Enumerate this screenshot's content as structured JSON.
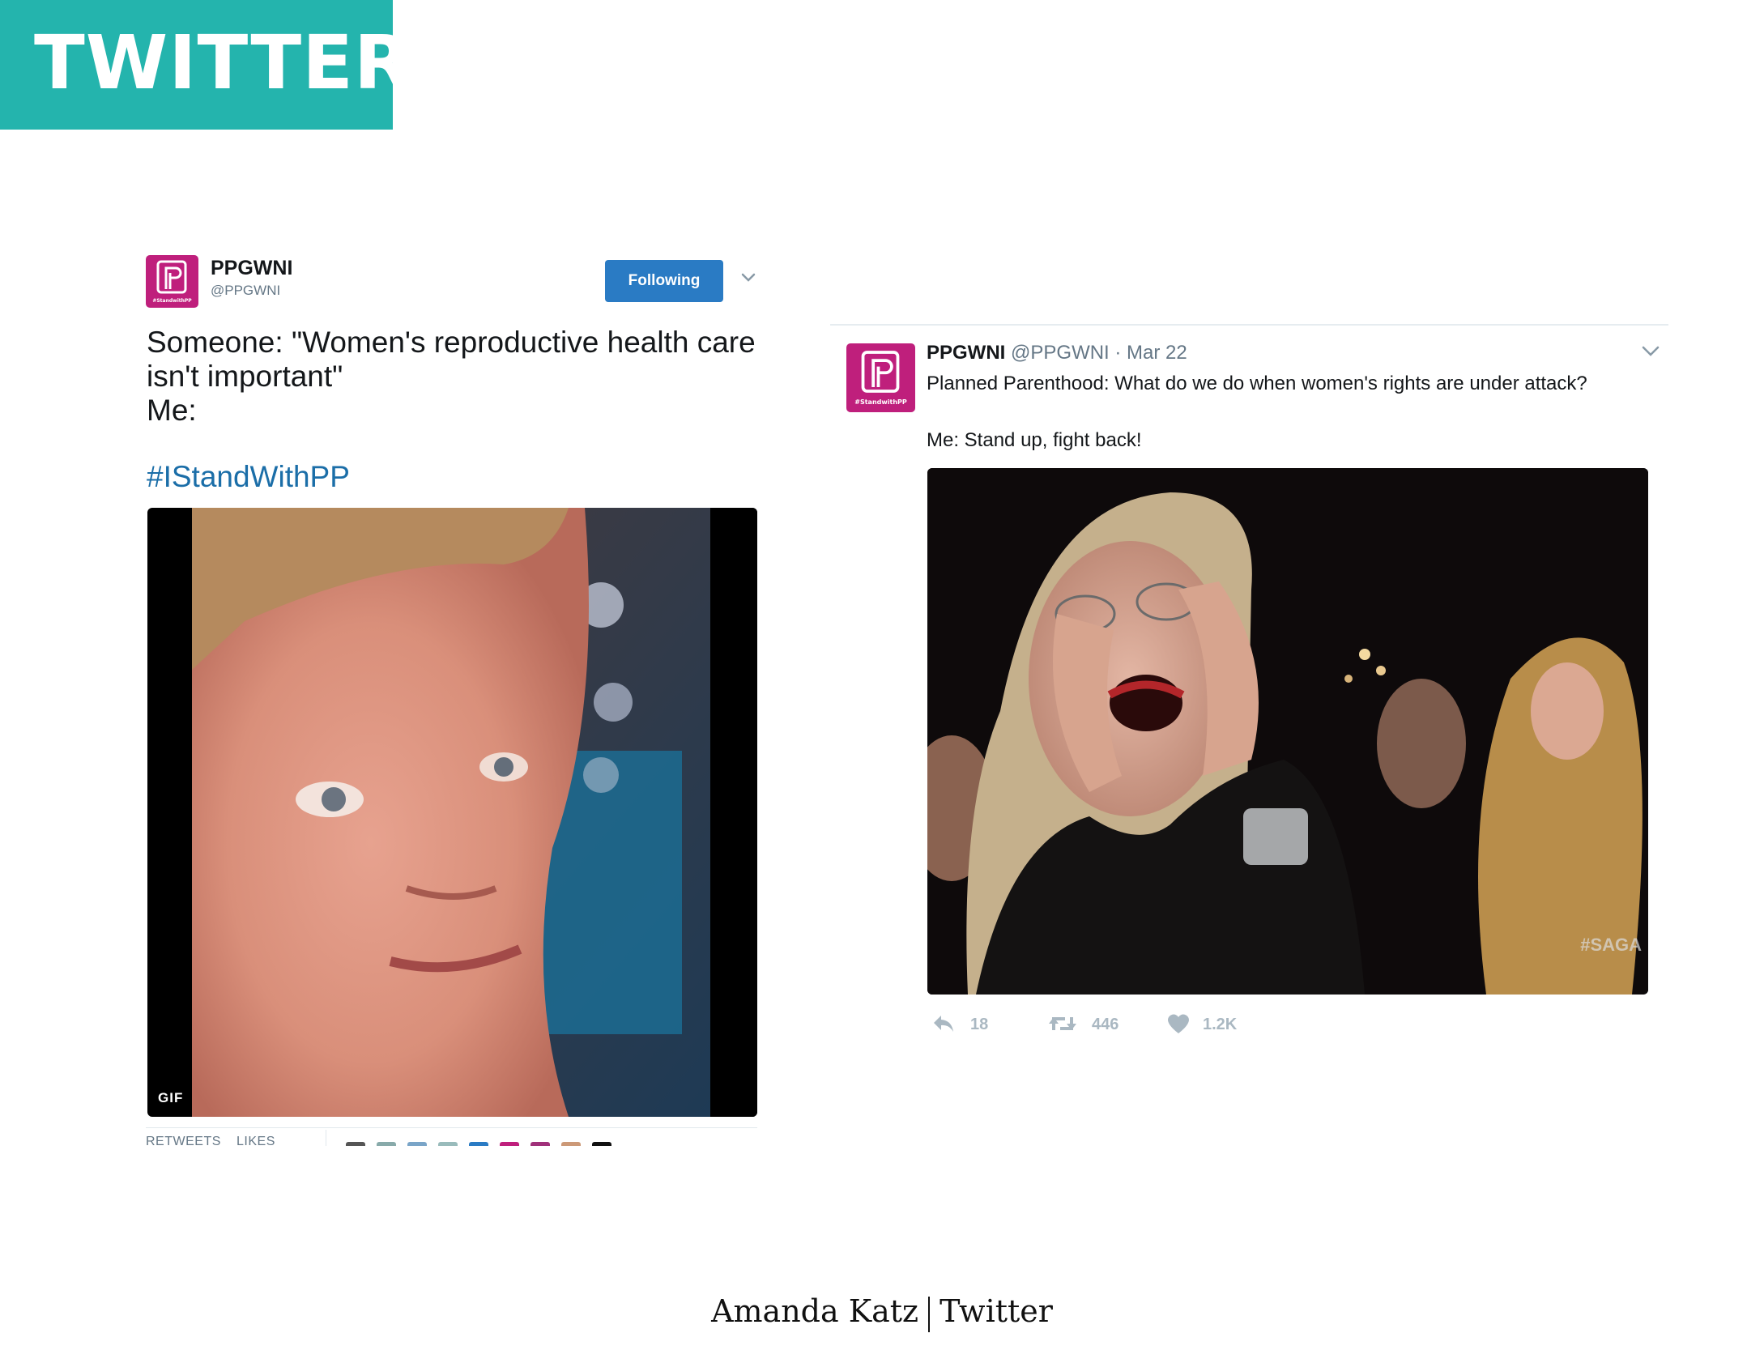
{
  "banner": {
    "title": "TWITTER"
  },
  "tweet_left": {
    "avatar_tag": "#StandwithPP",
    "name": "PPGWNI",
    "handle": "@PPGWNI",
    "follow_label": "Following",
    "body_lines": [
      "Someone: \"Women's reproductive health care",
      "isn't important\"",
      "Me:"
    ],
    "hashtag": "#IStandWithPP",
    "gif_badge": "GIF",
    "stats_retweets_label": "RETWEETS",
    "stats_likes_label": "LIKES"
  },
  "tweet_right": {
    "avatar_tag": "#StandwithPP",
    "name": "PPGWNI",
    "handle_date": "@PPGWNI · Mar 22",
    "text_line1": "Planned Parenthood: What do we do when women's rights are under attack?",
    "text_line2": "Me: Stand up, fight back!",
    "watermark": "#SAGA",
    "reply_count": "18",
    "retweet_count": "446",
    "like_count": "1.2K"
  },
  "footer": {
    "author": "Amanda Katz",
    "section": "Twitter"
  },
  "colors": {
    "banner": "#24b4ad",
    "brand_pink": "#bf1f7c",
    "follow_blue": "#2a7bc4",
    "hashtag_blue": "#1b6ea8",
    "muted_gray": "#657786"
  },
  "icons": [
    "chevron-down-icon",
    "reply-icon",
    "retweet-icon",
    "heart-icon",
    "pp-logo-icon"
  ]
}
